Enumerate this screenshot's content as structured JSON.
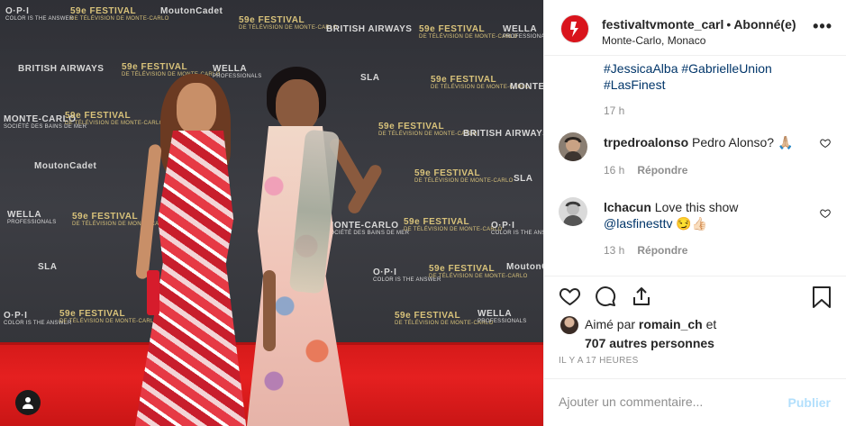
{
  "photo": {
    "sponsors": [
      {
        "text": "O·P·I",
        "sub": "COLOR IS THE ANSWER"
      },
      {
        "text": "59e FESTIVAL",
        "sub": "DE TÉLÉVISION DE MONTE-CARLO"
      },
      {
        "text": "MoutonCadet",
        "sub": ""
      },
      {
        "text": "BRITISH AIRWAYS",
        "sub": ""
      },
      {
        "text": "WELLA",
        "sub": "PROFESSIONALS"
      },
      {
        "text": "SLA",
        "sub": ""
      },
      {
        "text": "MONTE-CARLO",
        "sub": "SOCIÉTÉ DES BAINS DE MER"
      }
    ],
    "profile_button_icon": "user-circle-icon"
  },
  "header": {
    "username": "festivaltvmonte_carl",
    "separator": "•",
    "follow_state": "Abonné(e)",
    "location": "Monte-Carlo, Monaco",
    "more_icon": "more-options-icon",
    "more_label": "•••"
  },
  "caption": {
    "hashtags_line1": "#JessicaAlba #GabrielleUnion",
    "hashtags_line2": "#LasFinest",
    "time": "17 h"
  },
  "comments": [
    {
      "user": "trpedroalonso",
      "text": "Pedro Alonso? 🙏🏼",
      "time": "16 h",
      "reply_label": "Répondre"
    },
    {
      "user": "lchacun",
      "text": "Love this show",
      "mention": "@lasfinesttv",
      "emoji": "😏👍🏻",
      "time": "13 h",
      "reply_label": "Répondre"
    }
  ],
  "actions": {
    "like_icon": "heart-icon",
    "comment_icon": "comment-icon",
    "share_icon": "share-icon",
    "save_icon": "bookmark-icon"
  },
  "likes": {
    "prefix": "Aimé par",
    "user": "romain_ch",
    "conjunction": "et",
    "others": "707 autres personnes"
  },
  "timestamp": "IL Y A 17 HEURES",
  "comment_box": {
    "placeholder": "Ajouter un commentaire...",
    "publish_label": "Publier"
  },
  "colors": {
    "link": "#003569",
    "muted": "#8e8e8e",
    "publish_disabled": "#b2dffc",
    "carpet": "#e52020"
  }
}
